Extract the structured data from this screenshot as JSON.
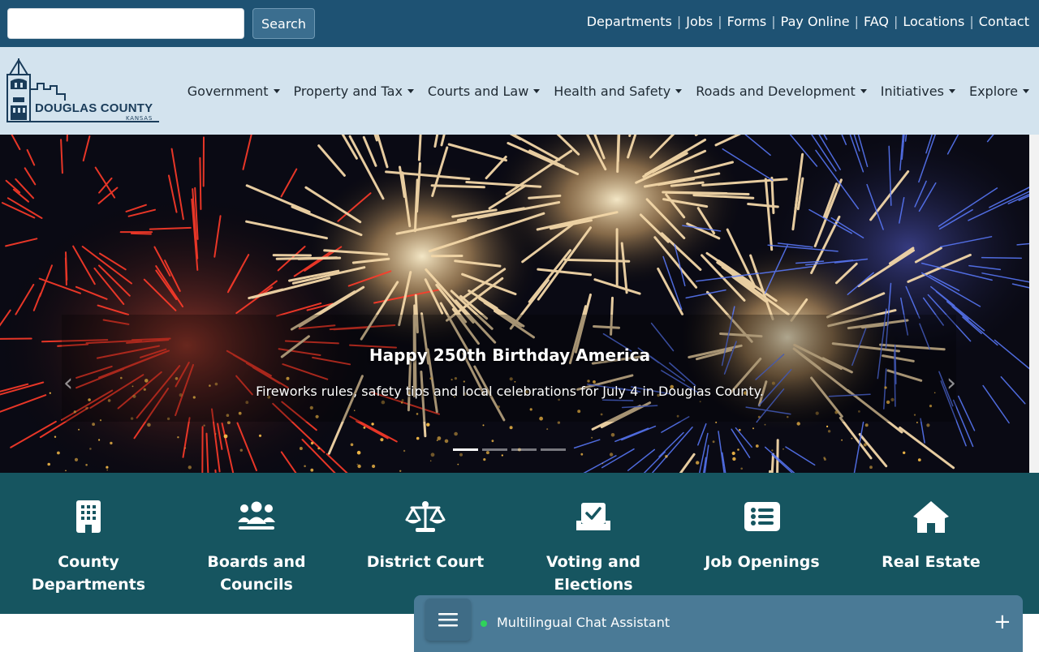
{
  "search": {
    "button_label": "Search",
    "value": ""
  },
  "utility_links": [
    {
      "label": "Departments"
    },
    {
      "label": "Jobs"
    },
    {
      "label": "Forms"
    },
    {
      "label": "Pay Online"
    },
    {
      "label": "FAQ"
    },
    {
      "label": "Locations"
    },
    {
      "label": "Contact"
    }
  ],
  "logo": {
    "name": "DOUGLAS COUNTY",
    "state": "KANSAS"
  },
  "nav": [
    {
      "label": "Government"
    },
    {
      "label": "Property and Tax"
    },
    {
      "label": "Courts and Law"
    },
    {
      "label": "Health and Safety"
    },
    {
      "label": "Roads and Development"
    },
    {
      "label": "Initiatives"
    },
    {
      "label": "Explore"
    }
  ],
  "hero": {
    "title": "Happy 250th Birthday America",
    "subtitle": "Fireworks rules, safety tips and local celebrations for July 4 in Douglas County.",
    "slide_count": 4,
    "active_slide": 1
  },
  "quick_links": [
    {
      "label": "County Departments",
      "icon": "building-icon"
    },
    {
      "label": "Boards and Councils",
      "icon": "users-icon"
    },
    {
      "label": "District Court",
      "icon": "scale-icon"
    },
    {
      "label": "Voting and Elections",
      "icon": "ballot-icon"
    },
    {
      "label": "Job Openings",
      "icon": "list-icon"
    },
    {
      "label": "Real Estate",
      "icon": "home-icon"
    }
  ],
  "chat": {
    "title": "Multilingual Chat Assistant",
    "status": "online"
  },
  "colors": {
    "topbar": "#1e5273",
    "header": "#d3e3ee",
    "quick_links": "#165560",
    "chat": "#4a7a96",
    "status_online": "#2fd35a"
  }
}
